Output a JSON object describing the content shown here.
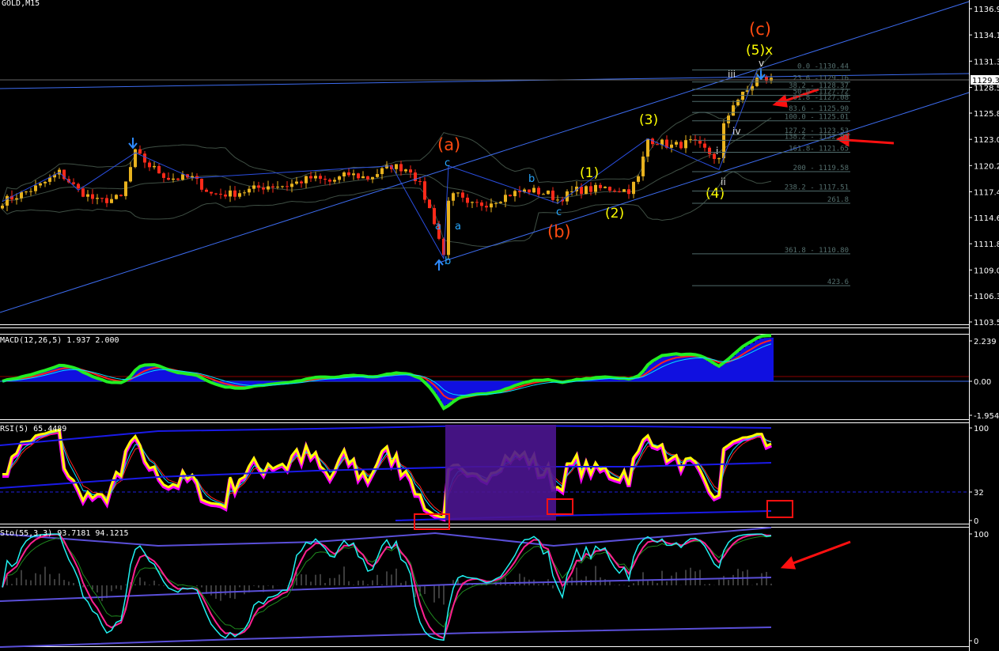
{
  "window": {
    "title": "GOLD,M15"
  },
  "colors": {
    "up": "#e8b21e",
    "down": "#ff2a1a",
    "channel": "#3d6cf0",
    "fib": "#4f6b6b",
    "wave_orange": "#ff4a10",
    "wave_yellow": "#ffff00",
    "wave_cyan": "#27a8ff",
    "arrow": "#ff1010"
  },
  "price_axis": {
    "ticks": [
      "1136.98",
      "1134.18",
      "1131.38",
      "1128.58",
      "1125.83",
      "1123.03",
      "1120.23",
      "1117.43",
      "1114.68",
      "1111.88",
      "1109.08",
      "1106.33",
      "1103.53"
    ],
    "current_price": "1129.38"
  },
  "fib_levels": [
    {
      "label": "0.0 -1130.44",
      "price": 1130.44
    },
    {
      "label": "23.6 -1129.16",
      "price": 1129.16
    },
    {
      "label": "38.2 - 1128.37",
      "price": 1128.37
    },
    {
      "label": "50.0 -1127.72",
      "price": 1127.72
    },
    {
      "label": "61.8 -1127.08",
      "price": 1127.08
    },
    {
      "label": "83.6 - 1125.90",
      "price": 1125.9
    },
    {
      "label": "100.0 - 1125.01",
      "price": 1125.01
    },
    {
      "label": "127.2 - 1123.53",
      "price": 1123.53
    },
    {
      "label": "138.2 - 1122.93",
      "price": 1122.93
    },
    {
      "label": "161.8- 1121.65",
      "price": 1121.65
    },
    {
      "label": "200 - 1119.58",
      "price": 1119.58
    },
    {
      "label": "238.2 - 1117.51",
      "price": 1117.51
    },
    {
      "label": "261.8",
      "price": 1116.2
    },
    {
      "label": "361.8 - 1110.80",
      "price": 1110.8
    },
    {
      "label": "423.6",
      "price": 1107.4
    }
  ],
  "waves": {
    "a_big": "(a)",
    "b_big": "(b)",
    "c_big": "(c)",
    "w1": "(1)",
    "w2": "(2)",
    "w3": "(3)",
    "w4": "(4)",
    "w5x": "(5)x",
    "sub_a1": "a",
    "sub_a2": "a",
    "sub_b1": "b",
    "sub_b2": "b",
    "sub_c1": "c",
    "sub_c2": "c",
    "i": "i",
    "ii": "ii",
    "iii": "iii",
    "iv": "iv",
    "v": "v"
  },
  "macd": {
    "label": "MACD(12,26,5) 1.937 2.000",
    "ticks": [
      "2.239",
      "0.00",
      "-1.954"
    ]
  },
  "rsi": {
    "label": "RSI(5) 65.4489",
    "ticks": [
      "100",
      "32",
      "0"
    ]
  },
  "stoch": {
    "label": "Sto(55,3,3) 93.7181 94.1215",
    "ticks": [
      "100",
      "0"
    ]
  },
  "price_path": [
    [
      0,
      1116.4
    ],
    [
      4,
      1117.2
    ],
    [
      8,
      1118.1
    ],
    [
      12,
      1119.5
    ],
    [
      16,
      1117.6
    ],
    [
      20,
      1116.4
    ],
    [
      25,
      1116.8
    ],
    [
      28,
      1121.6
    ],
    [
      31,
      1120.2
    ],
    [
      35,
      1118.9
    ],
    [
      40,
      1118.9
    ],
    [
      44,
      1117.2
    ],
    [
      48,
      1117.2
    ],
    [
      52,
      1117.6
    ],
    [
      56,
      1118.1
    ],
    [
      60,
      1118.1
    ],
    [
      65,
      1118.9
    ],
    [
      69,
      1118.5
    ],
    [
      73,
      1119.3
    ],
    [
      77,
      1118.9
    ],
    [
      82,
      1120.2
    ],
    [
      86,
      1119.8
    ],
    [
      88,
      1118.1
    ],
    [
      91,
      1114.3
    ],
    [
      93,
      1110.6
    ],
    [
      94,
      1116.8
    ],
    [
      96,
      1117.0
    ],
    [
      98,
      1115.9
    ],
    [
      102,
      1116.2
    ],
    [
      107,
      1117.2
    ],
    [
      111,
      1117.6
    ],
    [
      115,
      1117.2
    ],
    [
      117,
      1116.6
    ],
    [
      121,
      1117.6
    ],
    [
      127,
      1117.8
    ],
    [
      132,
      1117.6
    ],
    [
      134,
      1118.9
    ],
    [
      136,
      1123.1
    ],
    [
      141,
      1122.3
    ],
    [
      145,
      1122.7
    ],
    [
      148,
      1121.9
    ],
    [
      151,
      1120.8
    ],
    [
      152,
      1124.4
    ],
    [
      154,
      1126.9
    ],
    [
      157,
      1128.2
    ],
    [
      159,
      1129.5
    ],
    [
      162,
      1129.4
    ]
  ]
}
